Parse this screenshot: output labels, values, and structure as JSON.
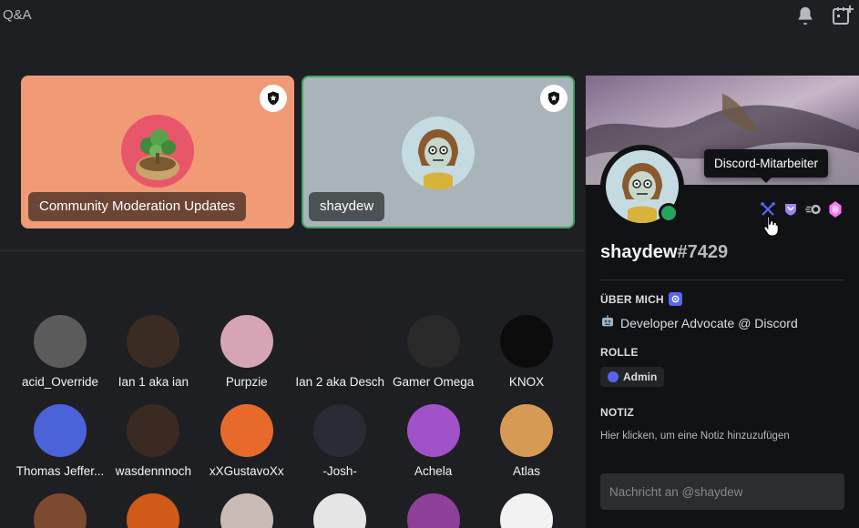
{
  "window": {
    "title": "Q&A"
  },
  "icons": {
    "bell": "bell-icon",
    "add_event": "calendar-plus-icon",
    "moderator_badge": "shield-star-icon",
    "cursor": "hand-pointer-icon"
  },
  "stage": {
    "tiles": [
      {
        "label": "Community Moderation Updates",
        "bg": "#f09a76",
        "speaking": false
      },
      {
        "label": "shaydew",
        "bg": "#a9b4ba",
        "speaking": true
      }
    ]
  },
  "audience": {
    "members": [
      {
        "name": "acid_Override",
        "color": "#5b5b5b"
      },
      {
        "name": "Ian 1 aka ian",
        "color": "#3a2c22"
      },
      {
        "name": "Purpzie",
        "color": "#d7a4b5"
      },
      {
        "name": "Ian 2 aka Desch",
        "color": "#1f1f22"
      },
      {
        "name": "Gamer Omega",
        "color": "#2a2a2a"
      },
      {
        "name": "KNOX",
        "color": "#0c0c0c"
      },
      {
        "name": "Thomas Jeffer...",
        "color": "#4b63d8"
      },
      {
        "name": "wasdennnoch",
        "color": "#3a2a22"
      },
      {
        "name": "xXGustavoXx",
        "color": "#e86a2b"
      },
      {
        "name": "-Josh-",
        "color": "#2b2b35"
      },
      {
        "name": "Achela",
        "color": "#a252c9"
      },
      {
        "name": "Atlas",
        "color": "#d79a54"
      },
      {
        "name": "",
        "color": "#7c4a30"
      },
      {
        "name": "",
        "color": "#d05a1a"
      },
      {
        "name": "",
        "color": "#c9bcb5"
      },
      {
        "name": "",
        "color": "#e5e5e5"
      },
      {
        "name": "",
        "color": "#8e3f9a"
      },
      {
        "name": "",
        "color": "#f2f2f2"
      }
    ]
  },
  "profile": {
    "username": "shaydew",
    "discriminator": "#7429",
    "tooltip": "Discord-Mitarbeiter",
    "badges": [
      "moderator-tools-icon",
      "hypesquad-icon",
      "nitro-icon",
      "boost-gem-icon"
    ],
    "about_heading": "ÜBER MICH",
    "about_text": "Developer Advocate @ Discord",
    "role_heading": "ROLLE",
    "role_name": "Admin",
    "role_color": "#5865f2",
    "note_heading": "NOTIZ",
    "note_placeholder": "Hier klicken, um eine Notiz hinzuzufügen",
    "message_placeholder": "Nachricht an @shaydew",
    "status": "online"
  }
}
